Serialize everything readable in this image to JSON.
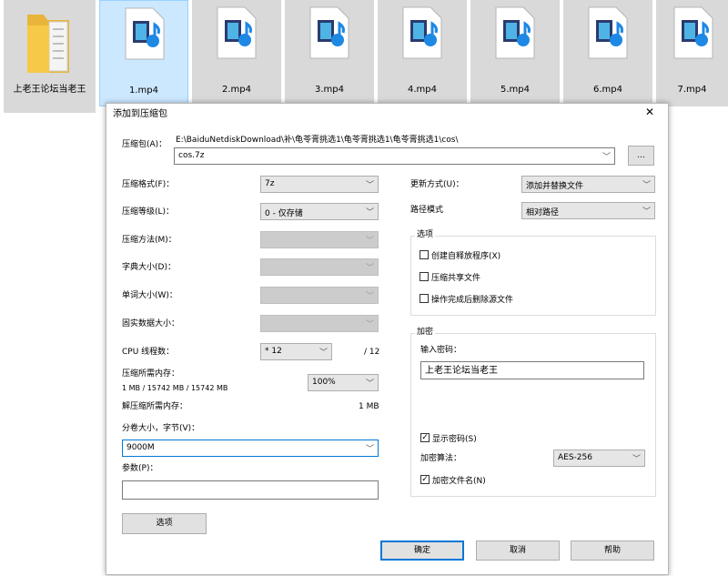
{
  "files": [
    {
      "name": "上老王论坛当老王",
      "type": "folder"
    },
    {
      "name": "1.mp4",
      "type": "media",
      "selected": true
    },
    {
      "name": "2.mp4",
      "type": "media"
    },
    {
      "name": "3.mp4",
      "type": "media"
    },
    {
      "name": "4.mp4",
      "type": "media"
    },
    {
      "name": "5.mp4",
      "type": "media"
    },
    {
      "name": "6.mp4",
      "type": "media"
    },
    {
      "name": "7.mp4",
      "type": "media"
    }
  ],
  "dialog": {
    "title": "添加到压缩包",
    "close": "✕",
    "archive_label": "压缩包(A)：",
    "archive_path": "E:\\BaiduNetdiskDownload\\补\\龟苓膏挑选1\\龟苓膏挑选1\\龟苓膏挑选1\\cos\\",
    "archive_name": "cos.7z",
    "browse": "...",
    "format": {
      "label": "压缩格式(F)：",
      "value": "7z"
    },
    "level": {
      "label": "压缩等级(L)：",
      "value": "0 - 仅存储"
    },
    "method": {
      "label": "压缩方法(M)："
    },
    "dict": {
      "label": "字典大小(D)："
    },
    "word": {
      "label": "单词大小(W)："
    },
    "solid": {
      "label": "固实数据大小："
    },
    "cpu": {
      "label": "CPU 线程数：",
      "value": "* 12",
      "total": "/ 12"
    },
    "mem_compress": {
      "label": "压缩所需内存：",
      "value": "1 MB / 15742 MB / 15742 MB",
      "percent": "100%"
    },
    "mem_decompress": {
      "label": "解压缩所需内存：",
      "value": "1 MB"
    },
    "volume": {
      "label": "分卷大小，字节(V)：",
      "value": "9000M"
    },
    "params": {
      "label": "参数(P)：",
      "value": ""
    },
    "options_btn": "选项",
    "update": {
      "label": "更新方式(U)：",
      "value": "添加并替换文件"
    },
    "path_mode": {
      "label": "路径模式",
      "value": "相对路径"
    },
    "options_group": {
      "title": "选项",
      "sfx": "创建自释放程序(X)",
      "shared": "压缩共享文件",
      "delete": "操作完成后删除源文件"
    },
    "encrypt": {
      "title": "加密",
      "pwd_label": "输入密码：",
      "pwd_value": "上老王论坛当老王",
      "show_pwd": "显示密码(S)",
      "method_label": "加密算法：",
      "method_value": "AES-256",
      "encrypt_names": "加密文件名(N)"
    },
    "ok": "确定",
    "cancel": "取消",
    "help": "帮助"
  }
}
